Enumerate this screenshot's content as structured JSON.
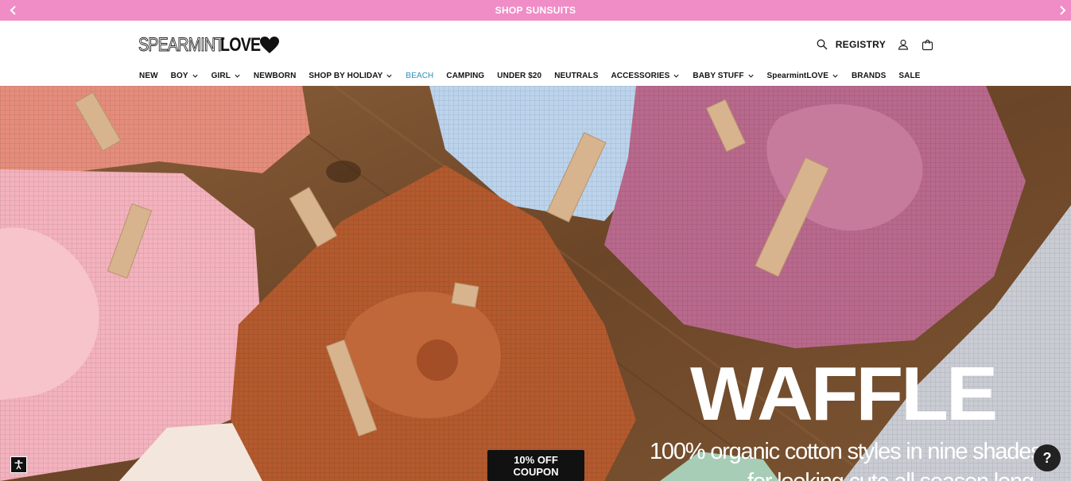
{
  "announcement": {
    "text": "SHOP SUNSUITS",
    "prev_icon": "chevron-left-icon",
    "next_icon": "chevron-right-icon"
  },
  "logo": {
    "thin": "SPEARMINT",
    "bold": "LOVE",
    "heart_icon": "heart-icon"
  },
  "utility": {
    "search_icon": "search-icon",
    "registry_label": "REGISTRY",
    "account_icon": "user-icon",
    "cart_icon": "cart-icon"
  },
  "nav": {
    "items": [
      {
        "label": "NEW",
        "dropdown": false
      },
      {
        "label": "BOY",
        "dropdown": true
      },
      {
        "label": "GIRL",
        "dropdown": true
      },
      {
        "label": "NEWBORN",
        "dropdown": false
      },
      {
        "label": "SHOP BY HOLIDAY",
        "dropdown": true
      },
      {
        "label": "BEACH",
        "dropdown": false,
        "active": true
      },
      {
        "label": "CAMPING",
        "dropdown": false
      },
      {
        "label": "UNDER $20",
        "dropdown": false
      },
      {
        "label": "NEUTRALS",
        "dropdown": false
      },
      {
        "label": "ACCESSORIES",
        "dropdown": true
      },
      {
        "label": "BABY STUFF",
        "dropdown": true
      },
      {
        "label": "SpearmintLOVE",
        "dropdown": true
      },
      {
        "label": "BRANDS",
        "dropdown": false
      },
      {
        "label": "SALE",
        "dropdown": false
      }
    ]
  },
  "hero": {
    "title": "WAFFLE",
    "subtitle": "100% organic cotton styles in nine shades",
    "subtitle_line2": "for looking cute all season long"
  },
  "coupon": {
    "line1": "10% OFF",
    "line2": "COUPON"
  },
  "help": {
    "label": "?"
  },
  "accessibility_icon": "accessibility-icon",
  "colors": {
    "announcement_bg": "#f08cc6",
    "active_nav": "#2a8fbf"
  }
}
